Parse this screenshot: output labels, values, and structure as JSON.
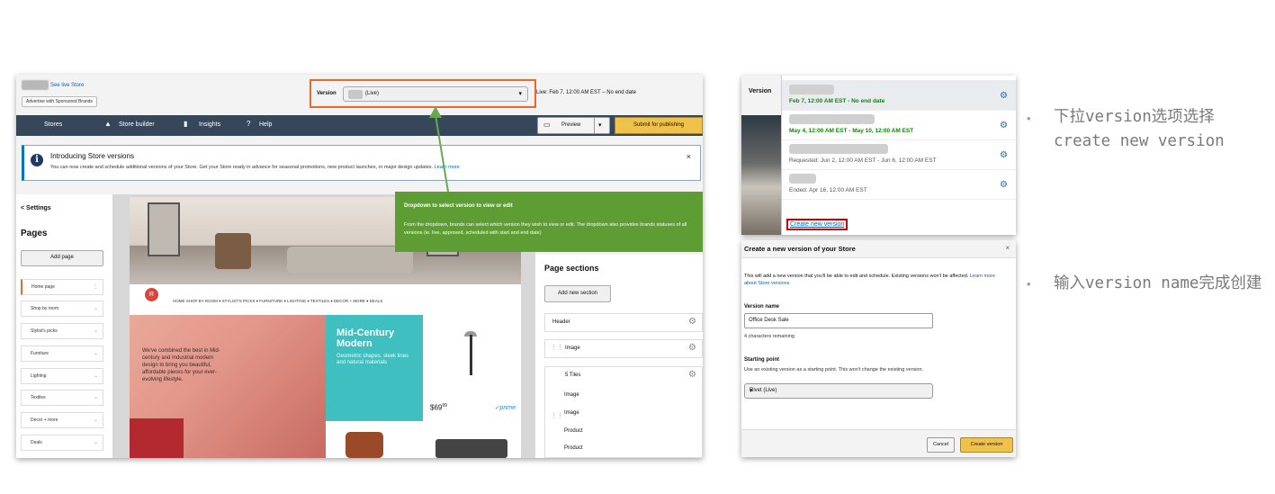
{
  "main": {
    "see_live": "See live Store",
    "advertise_btn": "Advertise with Sponsored Brands",
    "version_label": "Version",
    "version_selected": "(Live)",
    "live_text": "Live: Feb 7, 12:00 AM EST – No end date",
    "nav": {
      "stores": "Stores",
      "store_builder": "Store builder",
      "insights": "Insights",
      "help": "Help",
      "preview": "Preview",
      "submit": "Submit for publishing"
    },
    "banner": {
      "title": "Introducing Store versions",
      "body": "You can now create and schedule additional versions of your Store. Get your Store ready in advance for seasonal promotions, new product launches, or major design updates.",
      "link": "Learn more",
      "close": "×"
    },
    "settings": "Settings",
    "pages_title": "Pages",
    "add_page": "Add page",
    "pages": [
      "Home page",
      "Shop by room",
      "Stylist's picks",
      "Furniture",
      "Lighting",
      "Textiles",
      "Decor + more",
      "Deals"
    ],
    "store_nav": "HOME   SHOP BY ROOM ▾   STYLIST'S PICKS ▾   FURNITURE ▾   LIGHTING ▾   TEXTILES ▾   DECOR + MORE ▾   DEALS",
    "tile_left_text": "We've combined the best in Mid-century and Industrial modern design to bring you beautiful, affordable pieces for your ever-evolving lifestyle.",
    "tile_teal_heading": "Mid-Century Modern",
    "tile_teal_text": "Geometric shapes, sleek lines and natural materials",
    "price": "$69",
    "price_cents": "99",
    "prime": "✓prime",
    "page_sections_title": "Page sections",
    "add_section": "Add new section",
    "sections": [
      "Header",
      "Image",
      "5 Tiles"
    ],
    "sub_sections": [
      "Image",
      "Image",
      "Product",
      "Product"
    ],
    "tooltip_title": "Dropdown to select version to view or edit",
    "tooltip_body": "From the dropdown, brands can select which version they wish to view or edit. The dropdown also provides brands statuses of all versions (ie. live, approved, scheduled with start and end date)"
  },
  "dropdown": {
    "label": "Version",
    "items": [
      {
        "text": "Feb 7, 12:00 AM EST - No end date",
        "style": "green"
      },
      {
        "text": "May 4, 12:00 AM EST - May 10, 12:00 AM EST",
        "style": "green"
      },
      {
        "text": "Requested: Jun 2, 12:00 AM EST - Jun 6, 12:00 AM EST",
        "style": "grey"
      },
      {
        "text": "Ended: Apr 16, 12:00 AM EST",
        "style": "grey"
      }
    ],
    "create_new": "Create new version"
  },
  "modal": {
    "title": "Create a new version of your Store",
    "close": "×",
    "description": "This will add a new version that you'll be able to edit and schedule. Existing versions won't be affected.",
    "description_link": "Learn more about Store versions",
    "version_name_label": "Version name",
    "version_name_value": "Office Desk Sale",
    "chars_remaining": "4 characters remaining",
    "starting_point_label": "Starting point",
    "starting_point_hint": "Use an existing version as a starting point. This won't change the existing version.",
    "starting_point_value": "Rivet (Live)",
    "cancel": "Cancel",
    "create": "Create version"
  },
  "bullets": {
    "b1": "下拉version选项选择create new version",
    "b2": "输入version name完成创建"
  },
  "colors": {
    "nav_bg": "#37475a",
    "accent_orange": "#e8692b",
    "tooltip_green": "#5e9d34",
    "arrow_green": "#6aa84f",
    "button_yellow": "#f0c14b",
    "link_blue": "#0066c0",
    "status_green": "#0b8a00",
    "highlight_red": "#cc0000"
  },
  "icons": {
    "info": "info-icon",
    "gear": "gear-icon",
    "caret": "chevron-down-icon",
    "close": "close-icon",
    "drag": "drag-handle-icon"
  }
}
